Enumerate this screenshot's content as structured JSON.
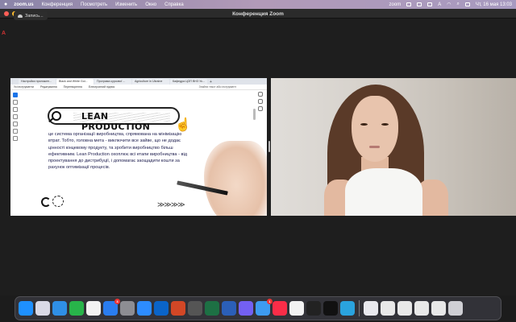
{
  "menubar": {
    "app": "zoom.us",
    "items": [
      "Конференция",
      "Посмотреть",
      "Изменить",
      "Окно",
      "Справка"
    ],
    "input_lang": "A",
    "datetime": "Чт, 16 мая  13:03",
    "zoom_label": "zoom"
  },
  "window": {
    "title": "Конференция Zoom",
    "recording_label": "Запись..."
  },
  "browser": {
    "tabs": [
      "Настройки приложен...",
      "Black and White Gol...",
      "Програма курсової ...",
      "Agriculture in Ukraine",
      "Кафедра ЦОП ВНЗ Ук..."
    ],
    "toolbar": [
      "Усі інструменти",
      "Редагування",
      "Перетворення",
      "Електронний підпис"
    ],
    "find_text": "Знайти текст або інструмент"
  },
  "slide": {
    "title": "LEAN PRODUCTION",
    "text": "це система організації виробництва, спрямована на мінімізацію втрат. Тобто, головна мета - виключити все зайве, що не додає цінності кінцевому продукту, та зробити виробництво більш ефективним. Lean Production охоплює всі етапи виробництва - від проектування до дистрибуції, і допомагає заощадити кошти за рахунок оптимізації процесів.",
    "arrows": "≫≫≫≫"
  },
  "dock": {
    "apps": [
      {
        "name": "Finder",
        "color": "#1e90ff",
        "badge": ""
      },
      {
        "name": "Launchpad",
        "color": "#d9d9e6",
        "badge": ""
      },
      {
        "name": "Safari",
        "color": "#2f8fe6",
        "badge": ""
      },
      {
        "name": "FaceTime",
        "color": "#28b44a",
        "badge": ""
      },
      {
        "name": "Photos",
        "color": "#f2f2f2",
        "badge": ""
      },
      {
        "name": "App Store",
        "color": "#2a7df0",
        "badge": "3"
      },
      {
        "name": "System Settings",
        "color": "#8d8d93",
        "badge": ""
      },
      {
        "name": "Zoom",
        "color": "#2d8cff",
        "badge": ""
      },
      {
        "name": "Outlook",
        "color": "#0a64c8",
        "badge": ""
      },
      {
        "name": "PowerPoint",
        "color": "#d24726",
        "badge": ""
      },
      {
        "name": "Photo Editor",
        "color": "#555",
        "badge": ""
      },
      {
        "name": "Excel",
        "color": "#1d7044",
        "badge": ""
      },
      {
        "name": "Word",
        "color": "#2b5fb8",
        "badge": ""
      },
      {
        "name": "Viber",
        "color": "#7360f2",
        "badge": ""
      },
      {
        "name": "Mail",
        "color": "#3d9bf0",
        "badge": "1"
      },
      {
        "name": "Music",
        "color": "#fa2d48",
        "badge": ""
      },
      {
        "name": "Chrome",
        "color": "#f2f2f2",
        "badge": ""
      },
      {
        "name": "Activity Monitor",
        "color": "#222",
        "badge": ""
      },
      {
        "name": "Terminal",
        "color": "#111",
        "badge": ""
      },
      {
        "name": "Telegram",
        "color": "#2aa3de",
        "badge": ""
      },
      {
        "name": "Preview",
        "color": "#e9e9ee",
        "badge": ""
      },
      {
        "name": "Document 1",
        "color": "#e8e8e8",
        "badge": ""
      },
      {
        "name": "Document 2",
        "color": "#e8e8e8",
        "badge": ""
      },
      {
        "name": "Document 3",
        "color": "#e8e8e8",
        "badge": ""
      },
      {
        "name": "Document 4",
        "color": "#e8e8e8",
        "badge": ""
      },
      {
        "name": "Trash",
        "color": "#cfcfd4",
        "badge": ""
      }
    ]
  }
}
